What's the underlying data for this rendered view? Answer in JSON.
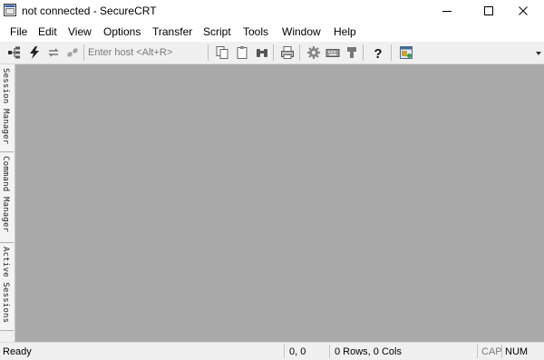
{
  "window": {
    "title": "not connected - SecureCRT",
    "minimize_icon": "minimize-icon",
    "maximize_icon": "maximize-icon",
    "close_icon": "close-icon"
  },
  "menu": {
    "items": [
      {
        "label": "File"
      },
      {
        "label": "Edit"
      },
      {
        "label": "View"
      },
      {
        "label": "Options"
      },
      {
        "label": "Transfer"
      },
      {
        "label": "Script"
      },
      {
        "label": "Tools"
      },
      {
        "label": "Window"
      },
      {
        "label": "Help"
      }
    ]
  },
  "toolbar": {
    "host_input": {
      "placeholder": "Enter host <Alt+R>",
      "value": ""
    },
    "icons": [
      "connect-tree-icon",
      "quick-connect-icon",
      "reconnect-icon",
      "disconnect-icon",
      "copy-icon",
      "paste-icon",
      "find-icon",
      "print-icon",
      "settings-icon",
      "keymap-icon",
      "sftp-icon",
      "help-icon",
      "session-options-icon"
    ]
  },
  "side_tabs": [
    {
      "label": "Session Manager"
    },
    {
      "label": "Command Manager"
    },
    {
      "label": "Active Sessions"
    }
  ],
  "status": {
    "ready": "Ready",
    "position": "0, 0",
    "size": "0 Rows, 0 Cols",
    "cap": "CAP",
    "num": "NUM"
  },
  "colors": {
    "workspace": "#a9a9a9",
    "toolbar": "#f0f0f0",
    "cap_inactive": "#7a7a7a"
  }
}
